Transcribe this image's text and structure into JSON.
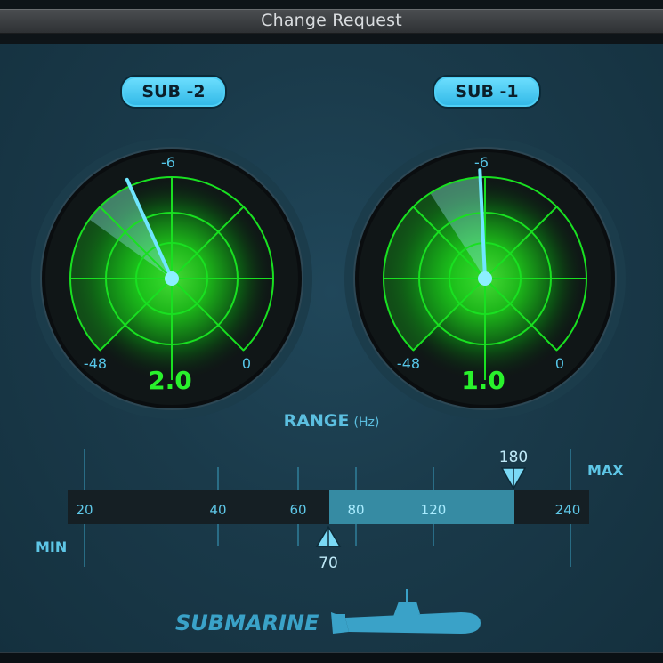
{
  "window": {
    "title": "Change Request"
  },
  "buttons": {
    "sub2": "SUB -2",
    "sub1": "SUB -1"
  },
  "meters": [
    {
      "id": "sub2",
      "value": "2.0",
      "scale_top": "-6",
      "scale_left": "-48",
      "scale_right": "0",
      "needle_level": 0.41
    },
    {
      "id": "sub1",
      "value": "1.0",
      "scale_top": "-6",
      "scale_left": "-48",
      "scale_right": "0",
      "needle_level": 0.49
    }
  ],
  "range": {
    "label": "RANGE",
    "unit": "(Hz)",
    "min_label": "MIN",
    "max_label": "MAX",
    "ticks": [
      "20",
      "40",
      "60",
      "80",
      "120",
      "240"
    ],
    "low_value": "70",
    "high_value": "180"
  },
  "logo": {
    "text": "SUBMARINE"
  },
  "colors": {
    "accent": "#3ec9f2",
    "meter_green": "#25ff2a",
    "range_fill": "#368ba3"
  }
}
